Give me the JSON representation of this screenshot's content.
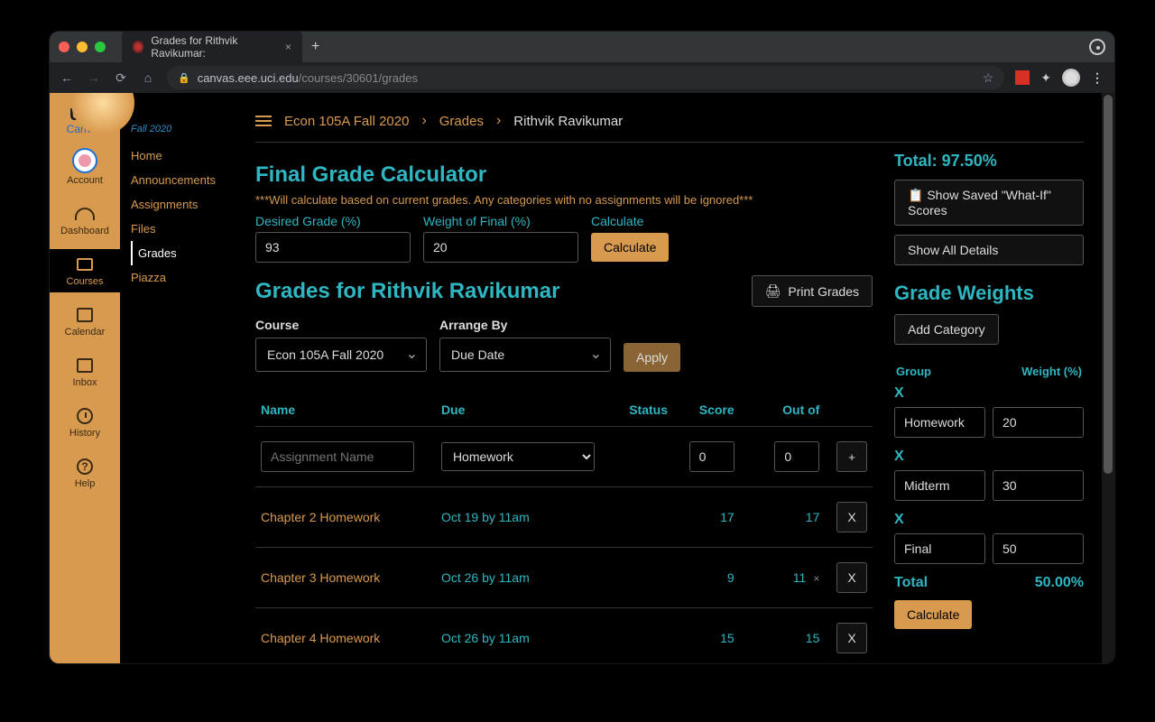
{
  "browser": {
    "tab_title": "Grades for Rithvik Ravikumar:",
    "url_host": "canvas.eee.uci.edu",
    "url_path": "/courses/30601/grades"
  },
  "rail": {
    "logo_line1": "UCI",
    "logo_line2": "Canvas",
    "items": [
      {
        "label": "Account"
      },
      {
        "label": "Dashboard"
      },
      {
        "label": "Courses"
      },
      {
        "label": "Calendar"
      },
      {
        "label": "Inbox"
      },
      {
        "label": "History"
      },
      {
        "label": "Help"
      }
    ]
  },
  "course_menu": {
    "term": "Fall 2020",
    "items": [
      {
        "label": "Home"
      },
      {
        "label": "Announcements"
      },
      {
        "label": "Assignments"
      },
      {
        "label": "Files"
      },
      {
        "label": "Grades",
        "active": true
      },
      {
        "label": "Piazza"
      }
    ]
  },
  "breadcrumb": {
    "course": "Econ 105A Fall 2020",
    "section": "Grades",
    "student": "Rithvik Ravikumar"
  },
  "calculator": {
    "title": "Final Grade Calculator",
    "note": "***Will calculate based on current grades. Any categories with no assignments will be ignored***",
    "desired_label": "Desired Grade (%)",
    "weight_label": "Weight of Final (%)",
    "calculate_label": "Calculate",
    "desired_value": "93",
    "weight_value": "20",
    "button": "Calculate"
  },
  "grades_header": {
    "title": "Grades for Rithvik Ravikumar",
    "print_label": "Print Grades"
  },
  "filters": {
    "course_label": "Course",
    "arrange_label": "Arrange By",
    "course_value": "Econ 105A Fall 2020",
    "arrange_value": "Due Date",
    "apply_label": "Apply"
  },
  "table": {
    "headers": {
      "name": "Name",
      "due": "Due",
      "status": "Status",
      "score": "Score",
      "out_of": "Out of"
    },
    "add_row": {
      "name_placeholder": "Assignment Name",
      "category_value": "Homework",
      "score_value": "0",
      "out_of_value": "0"
    },
    "rows": [
      {
        "name": "Chapter 2 Homework",
        "due": "Oct 19 by 11am",
        "score": "17",
        "out_of": "17",
        "muted": false
      },
      {
        "name": "Chapter 3 Homework",
        "due": "Oct 26 by 11am",
        "score": "9",
        "out_of": "11",
        "muted": true
      },
      {
        "name": "Chapter 4 Homework",
        "due": "Oct 26 by 11am",
        "score": "15",
        "out_of": "15",
        "muted": false
      }
    ]
  },
  "sidebar": {
    "total_label": "Total: 97.50%",
    "whatif_label": "Show Saved \"What-If\" Scores",
    "details_label": "Show All Details",
    "weights_title": "Grade Weights",
    "add_category_label": "Add Category",
    "group_header": "Group",
    "weight_header": "Weight (%)",
    "rows": [
      {
        "group": "Homework",
        "weight": "20"
      },
      {
        "group": "Midterm",
        "weight": "30"
      },
      {
        "group": "Final",
        "weight": "50"
      }
    ],
    "remove_label": "X",
    "total_row_label": "Total",
    "total_row_value": "50.00%",
    "calculate_label": "Calculate"
  }
}
